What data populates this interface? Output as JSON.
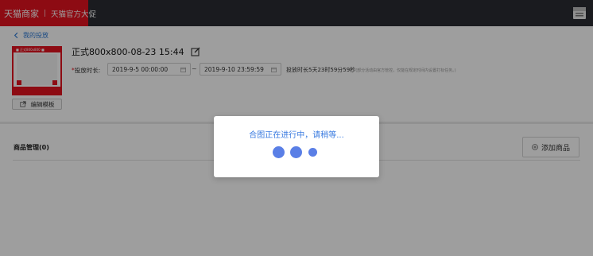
{
  "topbar": {
    "brand": "天猫商家",
    "separator": "|",
    "sub": "天猫官方大促",
    "right_icon": "store-icon",
    "brand_color": "#e4131f"
  },
  "nav": {
    "back_label": "我的投放",
    "back_icon": "chevron-left-icon"
  },
  "thumbnail": {
    "top_text": "■ 正式800x800 ■",
    "edit_template_label": "编辑模板",
    "edit_icon": "external-edit-icon"
  },
  "campaign": {
    "title": "正式800x800-08-23 15:44",
    "title_edit_icon": "edit-icon"
  },
  "duration": {
    "required_mark": "*",
    "label": "投放时长:",
    "start": "2019-9-5 00:00:00",
    "separator": "~",
    "end": "2019-9-10 23:59:59",
    "summary": "投放时长5天23时59分59秒",
    "note": "(部分活动由官方管控，仅能在规定时间内设置打标任务。)",
    "calendar_icon": "calendar-icon"
  },
  "goods": {
    "title": "商品管理(0)",
    "add_label": "添加商品",
    "add_icon": "plus-circle-icon"
  },
  "modal": {
    "message": "合图正在进行中，请稍等...",
    "loading_icon": "loading-dots-icon",
    "accent_color": "#5a7fe6"
  }
}
